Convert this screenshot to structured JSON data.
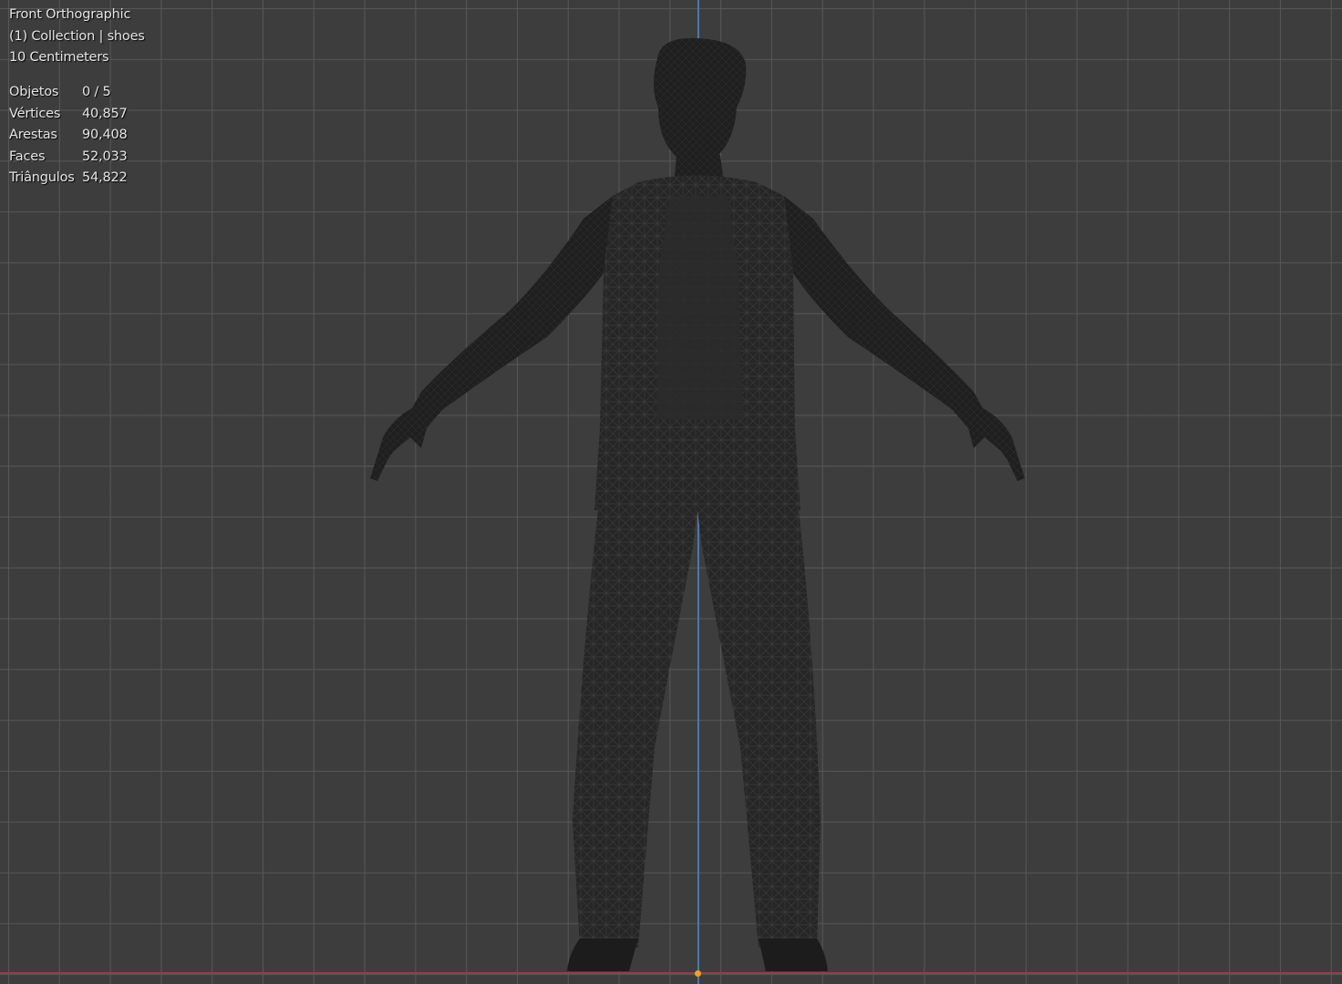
{
  "viewport": {
    "view_name": "Front Orthographic",
    "collection": "(1) Collection | shoes",
    "grid_scale": "10 Centimeters",
    "colors": {
      "background": "#3d3d3d",
      "grid": "#5a5a5a",
      "z_axis": "#4a78b0",
      "x_axis": "#9b3b45",
      "origin": "#f0a020",
      "model": "#1e1e1e"
    }
  },
  "stats": [
    {
      "label": "Objetos",
      "value": "0 / 5"
    },
    {
      "label": "Vértices",
      "value": "40,857"
    },
    {
      "label": "Arestas",
      "value": "90,408"
    },
    {
      "label": "Faces",
      "value": "52,033"
    },
    {
      "label": "Triângulos",
      "value": "54,822"
    }
  ]
}
